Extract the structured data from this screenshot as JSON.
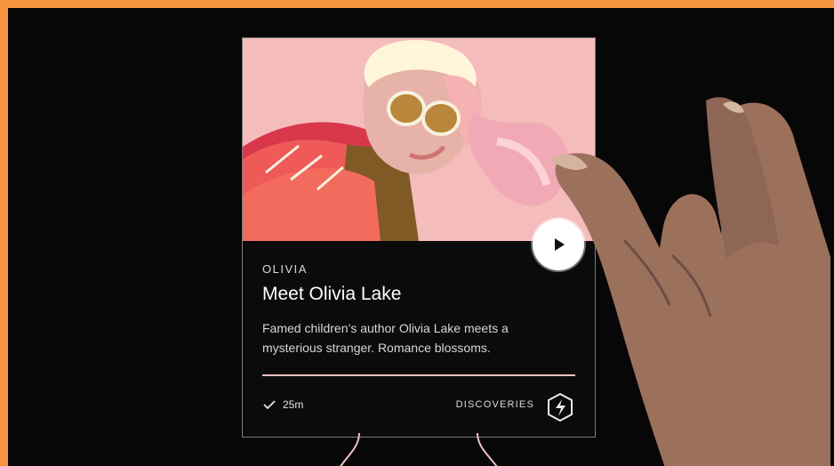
{
  "card": {
    "eyebrow": "OLIVIA",
    "title": "Meet Olivia Lake",
    "description": "Famed children’s author Olivia Lake meets a mysterious stranger. Romance blossoms.",
    "duration": "25m",
    "tag": "DISCOVERIES"
  },
  "icons": {
    "play": "play-icon",
    "check": "check-icon",
    "tag": "lightning-hexagon-icon"
  },
  "colors": {
    "orange_frame": "#f7953f",
    "card_background": "#0b0b0c",
    "hero_pink": "#f5bcbc",
    "accent_pink": "#f4c1c1"
  }
}
